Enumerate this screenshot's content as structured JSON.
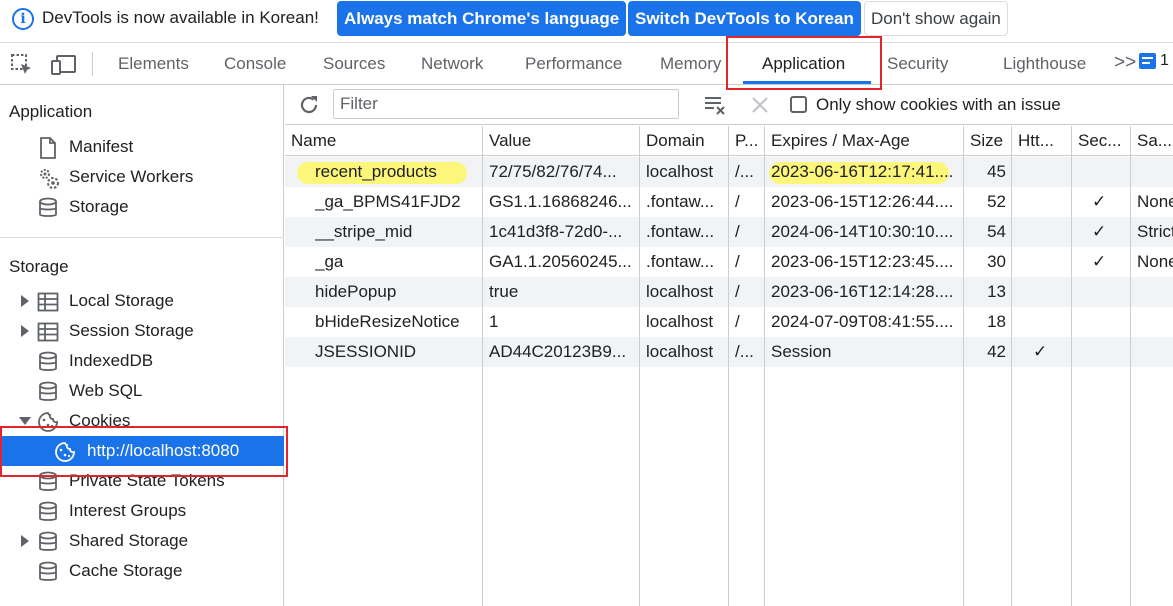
{
  "infobar": {
    "message": "DevTools is now available in Korean!",
    "btn_match": "Always match Chrome's language",
    "btn_switch": "Switch DevTools to Korean",
    "btn_dismiss": "Don't show again"
  },
  "tabs": [
    "Elements",
    "Console",
    "Sources",
    "Network",
    "Performance",
    "Memory",
    "Application",
    "Security",
    "Lighthouse"
  ],
  "tabs_more": ">>",
  "issues_badge": "1",
  "sidebar": {
    "application_title": "Application",
    "application_items": [
      "Manifest",
      "Service Workers",
      "Storage"
    ],
    "storage_title": "Storage",
    "storage_items": [
      "Local Storage",
      "Session Storage",
      "IndexedDB",
      "Web SQL",
      "Cookies",
      "http://localhost:8080",
      "Private State Tokens",
      "Interest Groups",
      "Shared Storage",
      "Cache Storage"
    ]
  },
  "toolbar": {
    "filter_placeholder": "Filter",
    "only_issue_label": "Only show cookies with an issue"
  },
  "table": {
    "headers": [
      "Name",
      "Value",
      "Domain",
      "P...",
      "Expires / Max-Age",
      "Size",
      "Htt...",
      "Sec...",
      "Sa..."
    ],
    "rows": [
      [
        "recent_products",
        "72/75/82/76/74...",
        "localhost",
        "/...",
        "2023-06-16T12:17:41....",
        "45",
        "",
        "",
        ""
      ],
      [
        "_ga_BPMS41FJD2",
        "GS1.1.16868246...",
        ".fontaw...",
        "/",
        "2023-06-15T12:26:44....",
        "52",
        "",
        "✓",
        "None"
      ],
      [
        "__stripe_mid",
        "1c41d3f8-72d0-...",
        ".fontaw...",
        "/",
        "2024-06-14T10:30:10....",
        "54",
        "",
        "✓",
        "Strict"
      ],
      [
        "_ga",
        "GA1.1.20560245...",
        ".fontaw...",
        "/",
        "2023-06-15T12:23:45....",
        "30",
        "",
        "✓",
        "None"
      ],
      [
        "hidePopup",
        "true",
        "localhost",
        "/",
        "2023-06-16T12:14:28....",
        "13",
        "",
        "",
        ""
      ],
      [
        "bHideResizeNotice",
        "1",
        "localhost",
        "/",
        "2024-07-09T08:41:55....",
        "18",
        "",
        "",
        ""
      ],
      [
        "JSESSIONID",
        "AD44C20123B9...",
        "localhost",
        "/...",
        "Session",
        "42",
        "✓",
        "",
        ""
      ]
    ]
  },
  "colors": {
    "accent": "#1a73e8",
    "highlight": "#fcf67a",
    "annotation_box": "#e0262c",
    "row_alt": "#f1f3f4"
  }
}
